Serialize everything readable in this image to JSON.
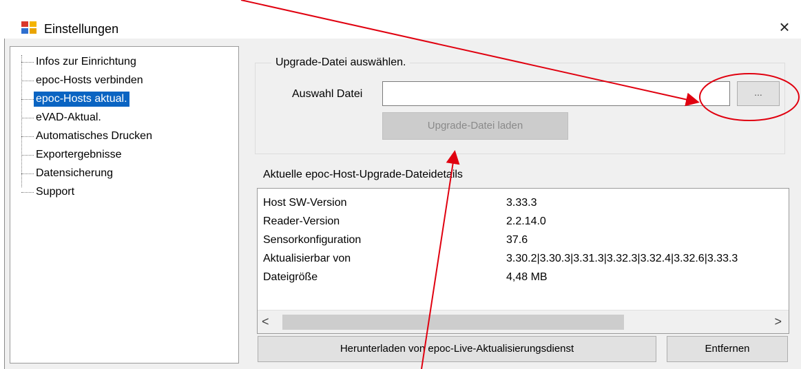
{
  "window": {
    "title": "Einstellungen",
    "close_label": "×"
  },
  "tree": {
    "items": [
      {
        "label": "Infos zur Einrichtung"
      },
      {
        "label": "epoc-Hosts verbinden"
      },
      {
        "label": "epoc-Hosts aktual.",
        "selected": true
      },
      {
        "label": "eVAD-Aktual."
      },
      {
        "label": "Automatisches Drucken"
      },
      {
        "label": "Exportergebnisse"
      },
      {
        "label": "Datensicherung"
      },
      {
        "label": "Support"
      }
    ]
  },
  "upgrade": {
    "group_title": "Upgrade-Datei auswählen.",
    "file_label": "Auswahl Datei",
    "file_value": "",
    "browse_label": "...",
    "load_label": "Upgrade-Datei laden"
  },
  "details": {
    "title": "Aktuelle epoc-Host-Upgrade-Dateidetails",
    "rows": [
      {
        "key": "Host SW-Version",
        "value": "3.33.3"
      },
      {
        "key": "Reader-Version",
        "value": "2.2.14.0"
      },
      {
        "key": "Sensorkonfiguration",
        "value": "37.6"
      },
      {
        "key": "Aktualisierbar von",
        "value": "3.30.2|3.30.3|3.31.3|3.32.3|3.32.4|3.32.6|3.33.3"
      },
      {
        "key": "Dateigröße",
        "value": "4,48 MB"
      }
    ],
    "scroll_left": "<",
    "scroll_right": ">"
  },
  "actions": {
    "download_label": "Herunterladen von epoc-Live-Aktualisierungsdienst",
    "remove_label": "Entfernen"
  },
  "colors": {
    "selection": "#0a64c2",
    "annotation": "#e0000f"
  }
}
